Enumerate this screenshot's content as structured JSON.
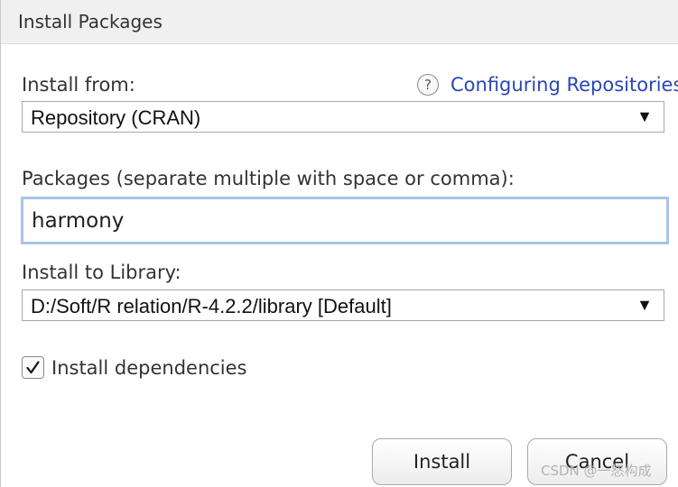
{
  "window": {
    "title": "Install Packages"
  },
  "install_from": {
    "label": "Install from:",
    "selected": "Repository (CRAN)",
    "arrow": "▼"
  },
  "help": {
    "icon": "help-circle-icon",
    "icon_glyph": "?",
    "link_text": "Configuring Repositories"
  },
  "packages": {
    "label": "Packages (separate multiple with space or comma):",
    "value": "harmony"
  },
  "library": {
    "label": "Install to Library:",
    "selected": "D:/Soft/R relation/R-4.2.2/library [Default]",
    "arrow": "▼"
  },
  "dependencies": {
    "label": "Install dependencies",
    "checked": true,
    "icon": "checkmark-icon"
  },
  "buttons": {
    "install": "Install",
    "cancel": "Cancel"
  },
  "watermark": "CSDN @一怒构成",
  "colors": {
    "link": "#2a46b5",
    "focus_border": "#a9c4ea",
    "titlebar_bg": "#f0f0f0"
  }
}
